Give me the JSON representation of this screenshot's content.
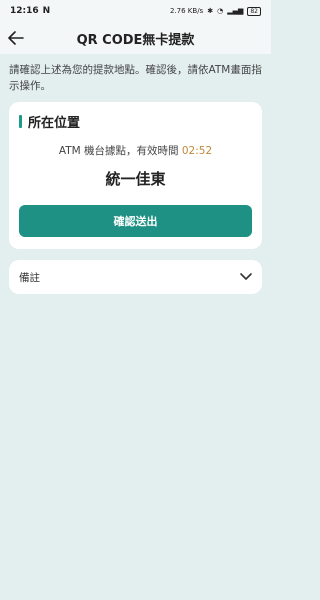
{
  "status_bar": {
    "time": "12:16",
    "carrier_icon": "N",
    "net_speed": "2.76 KB/s",
    "battery": "82"
  },
  "header": {
    "title": "QR CODE無卡提款"
  },
  "instruction": "請確認上述為您的提款地點。確認後，請依ATM畫面指示操作。",
  "location_card": {
    "title": "所在位置",
    "atm_text": "ATM 機台據點，有效時間",
    "countdown": "02:52",
    "location_name": "統一佳東",
    "confirm_label": "確認送出"
  },
  "notes": {
    "label": "備註"
  },
  "colors": {
    "accent": "#1e9184",
    "timer": "#c08a3a",
    "background": "#e3eeee"
  }
}
